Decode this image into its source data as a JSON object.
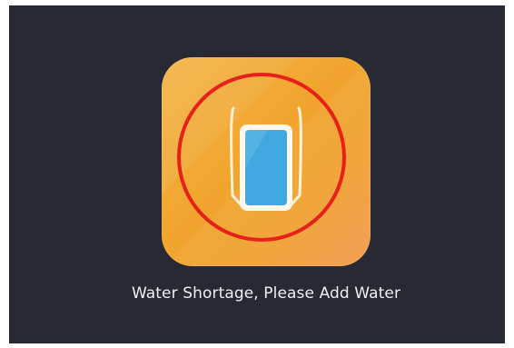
{
  "screen": {
    "background_color": "#272a33"
  },
  "icon": {
    "name": "water-tank-icon",
    "tile_color": "#f1a52e",
    "alert_ring_color": "#e8201a",
    "water_color": "#3fa8e0"
  },
  "message": {
    "text": "Water Shortage, Please Add Water"
  }
}
